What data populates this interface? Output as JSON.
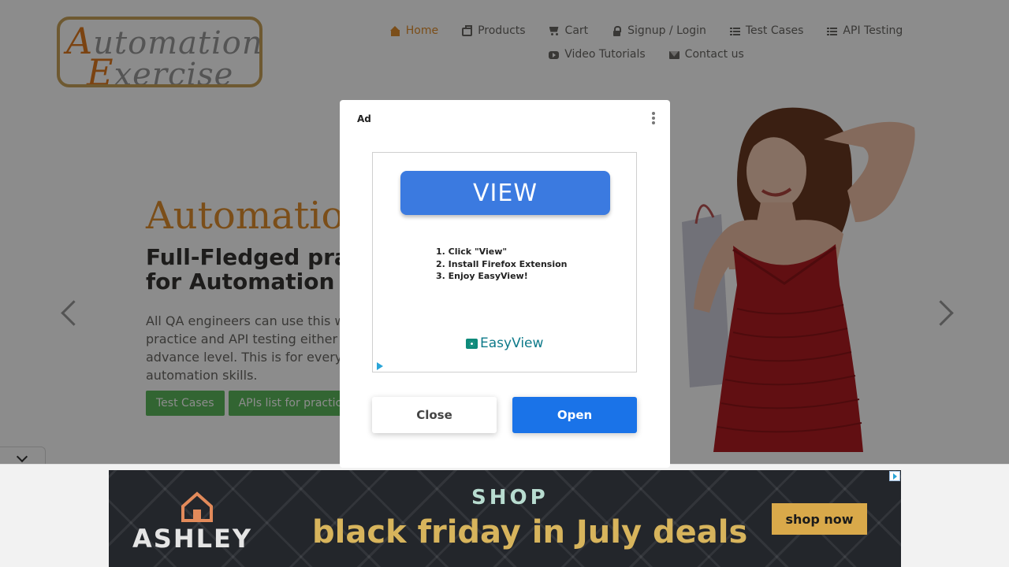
{
  "logo": {
    "line1_cap": "A",
    "line1_rest": "utomation",
    "line2_cap": "E",
    "line2_rest": "xercise"
  },
  "nav": {
    "items": [
      {
        "label": "Home",
        "icon": "home-icon",
        "active": true
      },
      {
        "label": "Products",
        "icon": "briefcase-icon"
      },
      {
        "label": "Cart",
        "icon": "shopping-cart-icon"
      },
      {
        "label": "Signup / Login",
        "icon": "lock-icon"
      },
      {
        "label": "Test Cases",
        "icon": "list-icon"
      },
      {
        "label": "API Testing",
        "icon": "list-icon"
      },
      {
        "label": "Video Tutorials",
        "icon": "youtube-play-icon"
      },
      {
        "label": "Contact us",
        "icon": "envelope-icon"
      }
    ]
  },
  "hero": {
    "title": "Automation",
    "subtitle_line1": "Full-Fledged pra",
    "subtitle_line2": "for Automation",
    "description": "All QA engineers can use this w practice and API testing either advance level. This is for every their automation skills.",
    "buttons": [
      "Test Cases",
      "APIs list for practic"
    ]
  },
  "modal_ad": {
    "label": "Ad",
    "view_button": "VIEW",
    "steps": [
      "1. Click \"View\"",
      "2. Install Firefox Extension",
      "3. Enjoy EasyView!"
    ],
    "brand": "EasyView",
    "close_label": "Close",
    "open_label": "Open",
    "open_color": "#1a73e8"
  },
  "banner_ad": {
    "brand": "ASHLEY",
    "shop": "SHOP",
    "headline": "black friday in July deals",
    "cta": "shop now"
  },
  "colors": {
    "accent": "#e08e2e",
    "success": "#5cb85c"
  }
}
